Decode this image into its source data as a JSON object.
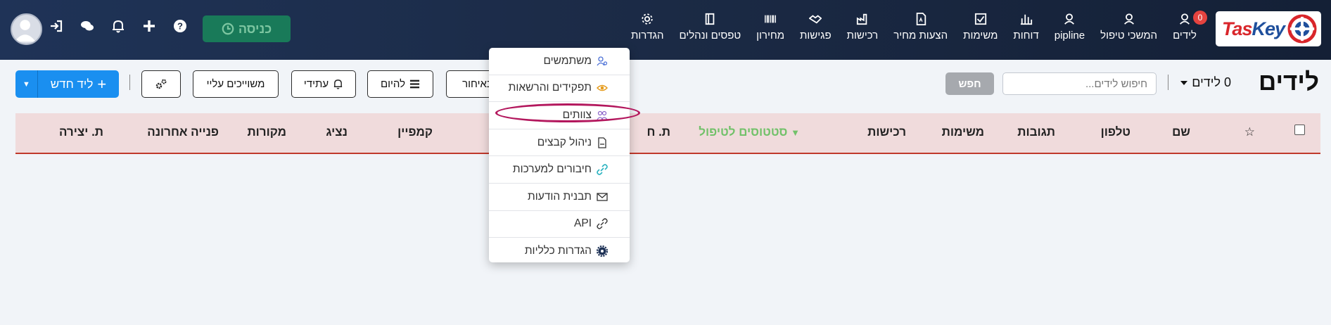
{
  "nav": {
    "logo": "TasKey",
    "items": [
      {
        "label": "לידים",
        "icon": "user-icon",
        "badge": "0"
      },
      {
        "label": "המשכי טיפול",
        "icon": "user-icon"
      },
      {
        "label": "pipline",
        "icon": "user-icon"
      },
      {
        "label": "דוחות",
        "icon": "bar-chart-icon"
      },
      {
        "label": "משימות",
        "icon": "checkbox-icon"
      },
      {
        "label": "הצעות מחיר",
        "icon": "document-icon"
      },
      {
        "label": "רכישות",
        "icon": "factory-icon"
      },
      {
        "label": "פגישות",
        "icon": "handshake-icon"
      },
      {
        "label": "מחירון",
        "icon": "barcode-icon"
      },
      {
        "label": "טפסים ונהלים",
        "icon": "book-icon"
      },
      {
        "label": "הגדרות",
        "icon": "gear-icon"
      }
    ],
    "clock_in_label": "כניסה"
  },
  "toolbar": {
    "title": "לידים",
    "count_label": "0 לידים",
    "search_placeholder": "חיפוש לידים...",
    "search_button": "חפש",
    "filter_buttons": [
      "באיחור",
      "להיום",
      "עתידי",
      "משוייכים עליי"
    ],
    "new_lead_label": "ליד חדש"
  },
  "table": {
    "columns": [
      "שם",
      "טלפון",
      "תגובות",
      "משימות",
      "רכישות",
      "סטטוסים לטיפול",
      "ת. ח",
      "קמפיין",
      "נציג",
      "מקורות",
      "פנייה אחרונה",
      "ת. יצירה"
    ]
  },
  "settings_menu": {
    "items": [
      {
        "label": "משתמשים",
        "icon": "users-icon"
      },
      {
        "label": "תפקידים והרשאות",
        "icon": "eye-icon"
      },
      {
        "label": "צוותים",
        "icon": "team-icon"
      },
      {
        "label": "ניהול קבצים",
        "icon": "file-icon"
      },
      {
        "label": "חיבורים למערכות",
        "icon": "link-icon"
      },
      {
        "label": "תבנית הודעות",
        "icon": "envelope-icon"
      },
      {
        "label": "API",
        "icon": "link-icon"
      },
      {
        "label": "הגדרות כלליות",
        "icon": "gear-icon"
      }
    ],
    "highlighted": "צוותים"
  },
  "colors": {
    "navbar": "#1b2a45",
    "accent": "#1a8ff0",
    "clock_in": "#197a59",
    "table_header_bg": "#f0dbdc",
    "status_green": "#72c16a",
    "highlight_ring": "#b3175d"
  }
}
